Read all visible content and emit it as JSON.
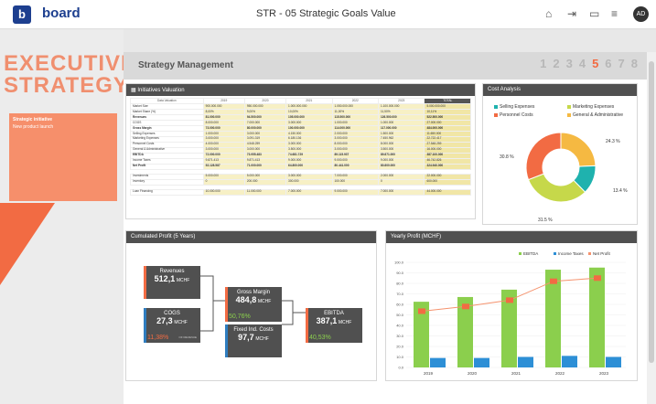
{
  "app": {
    "logo_letter": "b",
    "logo_word": "board",
    "title": "STR - 05 Strategic Goals Value",
    "avatar": "AD"
  },
  "left": {
    "word1": "EXECUTIVE",
    "word2": "STRATEGY",
    "note_title": "Strategic initiative",
    "note_body": "New product launch"
  },
  "header": {
    "title": "Strategy Management",
    "pages": [
      "1",
      "2",
      "3",
      "4",
      "5",
      "6",
      "7",
      "8"
    ],
    "active": "5"
  },
  "initiatives": {
    "title": "Initiatives Valuation",
    "columns": [
      "Data Valuation",
      "2019",
      "2020",
      "2021",
      "2022",
      "2023",
      "TOTAL"
    ],
    "rows": [
      [
        "Market Size",
        "900.000.000",
        "950.000.000",
        "1.000.000.000",
        "1.050.000.000",
        "1.100.000.000",
        "5.000.000.000"
      ],
      [
        "Market Share (%)",
        "8,00%",
        "9,00%",
        "10,00%",
        "11,00%",
        "11,50%",
        "10,11%"
      ],
      [
        "Revenues",
        "81.000.000",
        "94.500.000",
        "105.000.000",
        "115.500.000",
        "126.500.000",
        "522.500.000"
      ],
      [
        "COGS",
        "8.000.000",
        "7.000.000",
        "3.000.000",
        "1.000.000",
        "1.000.000",
        "27.000.000"
      ],
      [
        "Gross Margin",
        "73.000.000",
        "80.000.000",
        "100.000.000",
        "114.000.000",
        "117.000.000",
        "484.000.000"
      ],
      [
        "Selling Expenses",
        "1.000.000",
        "3.000.000",
        "4.150.000",
        "2.000.000",
        "1.500.000",
        "11.650.000"
      ],
      [
        "Marketing Expenses",
        "3.000.000",
        "3.091.319",
        "6.180.136",
        "3.000.000",
        "7.450.962",
        "22.722.417"
      ],
      [
        "Personnel Costs",
        "4.000.000",
        "4.548.259",
        "3.000.000",
        "8.000.000",
        "8.000.000",
        "27.548.259"
      ],
      [
        "General & Administrative",
        "3.000.000",
        "3.000.000",
        "3.500.000",
        "3.000.000",
        "3.500.000",
        "16.000.000"
      ],
      [
        "EBITDA",
        "72.000.000",
        "73.955.483",
        "74.681.729",
        "89.115.937",
        "89.871.000",
        "387.100.000"
      ],
      [
        "Income Taxes",
        "9.871.413",
        "9.871.413",
        "9.000.000",
        "9.000.000",
        "9.000.000",
        "46.742.826"
      ],
      [
        "Net Profit",
        "52.128.587",
        "71.000.000",
        "64.800.000",
        "80.441.000",
        "80.800.000",
        "324.940.000"
      ],
      [
        "Investments",
        "5.000.000",
        "5.000.000",
        "3.000.000",
        "7.000.000",
        "2.000.000",
        "22.000.000"
      ],
      [
        "Inventory",
        "0",
        "200.000",
        "300.000",
        "100.000",
        "0",
        "600.000"
      ],
      [
        "Loan Financing",
        "10.000.000",
        "11.000.000",
        "7.000.000",
        "9.000.000",
        "7.000.000",
        "44.000.000"
      ]
    ]
  },
  "cost_analysis": {
    "title": "Cost Analysis",
    "legend": [
      "Selling Expenses",
      "Marketing Expenses",
      "Personnel Costs",
      "General & Administrative"
    ],
    "colors": [
      "#1fb2ae",
      "#c6d84a",
      "#f26b43",
      "#f5b942"
    ],
    "chart_data": {
      "type": "pie",
      "labels": [
        "Selling Expenses",
        "Marketing Expenses",
        "Personnel Costs",
        "General & Administrative"
      ],
      "values": [
        13.4,
        31.5,
        30.8,
        24.3
      ]
    },
    "labels": [
      "13.4 %",
      "31.5 %",
      "30.8 %",
      "24.3 %"
    ]
  },
  "cumulated": {
    "title": "Cumulated Profit (5 Years)",
    "boxes": [
      {
        "label": "Revenues",
        "value": "512,1",
        "unit": "MCHF",
        "pct": "",
        "note": ""
      },
      {
        "label": "COGS",
        "value": "27,3",
        "unit": "MCHF",
        "pct": "11,38%",
        "note": "OF REVENUE"
      },
      {
        "label": "Gross Margin",
        "value": "484,8",
        "unit": "MCHF",
        "pct": "50,76%",
        "note": ""
      },
      {
        "label": "Fixed Ind. Costs",
        "value": "97,7",
        "unit": "MCHF",
        "pct": "",
        "note": ""
      },
      {
        "label": "EBITDA",
        "value": "387,1",
        "unit": "MCHF",
        "pct": "40,53%",
        "note": ""
      }
    ]
  },
  "yearly": {
    "title": "Yearly Profit (MCHF)",
    "legend": [
      "EBITDA",
      "Income Taxes",
      "Net Profit"
    ],
    "colors": [
      "#8bcf4d",
      "#2d8fd6",
      "#f5926d"
    ],
    "chart_data": {
      "type": "bar",
      "categories": [
        "2019",
        "2020",
        "2021",
        "2022",
        "2023"
      ],
      "series": [
        {
          "name": "EBITDA",
          "values": [
            62.5,
            67,
            74,
            93,
            95
          ]
        },
        {
          "name": "Income Taxes",
          "values": [
            9,
            9,
            10,
            11,
            10
          ]
        },
        {
          "name": "Net Profit",
          "values": [
            53.5,
            58,
            64,
            82,
            85
          ]
        }
      ],
      "ylim": [
        0,
        100
      ],
      "yticks": [
        "0.0",
        "10.0",
        "20.0",
        "30.0",
        "40.0",
        "50.0",
        "60.0",
        "70.0",
        "80.0",
        "90.0",
        "100.0"
      ]
    }
  }
}
